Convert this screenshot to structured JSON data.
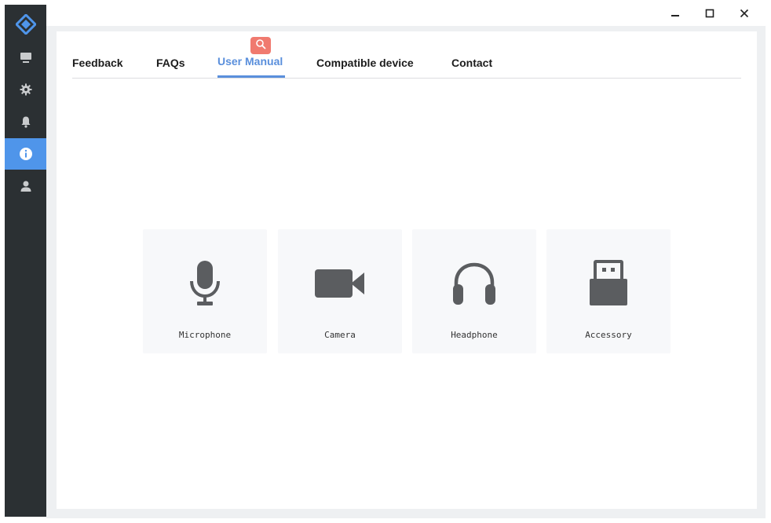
{
  "colors": {
    "sidebar_bg": "#2b3033",
    "sidebar_active": "#4f95ea",
    "accent": "#5a8fdc",
    "badge": "#f07a6f",
    "icon_gray": "#5b5d60"
  },
  "sidebar": {
    "items": [
      {
        "name": "monitor-icon",
        "active": false
      },
      {
        "name": "gear-icon",
        "active": false
      },
      {
        "name": "bell-icon",
        "active": false
      },
      {
        "name": "info-icon",
        "active": true
      },
      {
        "name": "user-icon",
        "active": false
      }
    ]
  },
  "window": {
    "controls": [
      "minimize-icon",
      "maximize-icon",
      "close-icon"
    ]
  },
  "tabs": {
    "feedback": "Feedback",
    "faqs": "FAQs",
    "user_manual": "User Manual",
    "compatible_device": "Compatible device",
    "contact": "Contact",
    "active": "user_manual"
  },
  "cards": {
    "microphone": {
      "label": "Microphone",
      "icon": "microphone-icon"
    },
    "camera": {
      "label": "Camera",
      "icon": "camera-icon"
    },
    "headphone": {
      "label": "Headphone",
      "icon": "headphone-icon"
    },
    "accessory": {
      "label": "Accessory",
      "icon": "usb-icon"
    }
  }
}
